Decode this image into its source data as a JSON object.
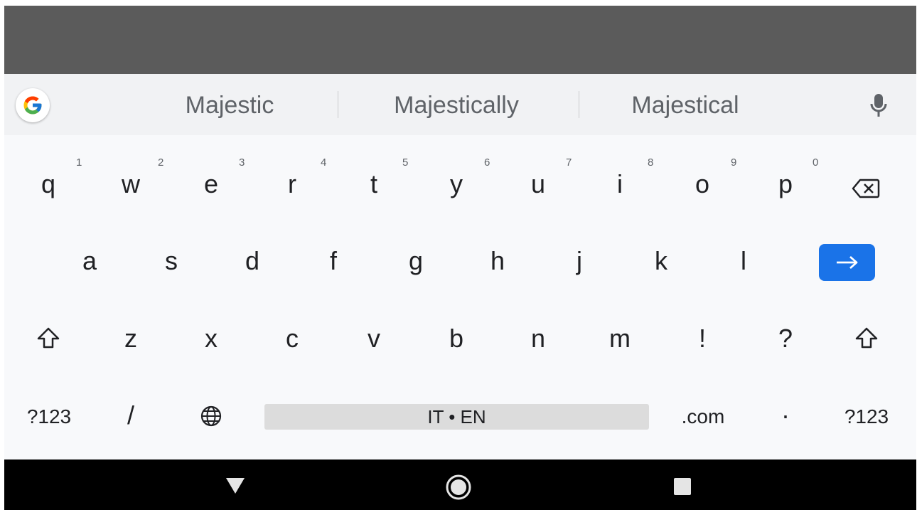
{
  "suggestions": [
    "Majestic",
    "Majestically",
    "Majestical"
  ],
  "row1": [
    {
      "ch": "q",
      "hint": "1"
    },
    {
      "ch": "w",
      "hint": "2"
    },
    {
      "ch": "e",
      "hint": "3"
    },
    {
      "ch": "r",
      "hint": "4"
    },
    {
      "ch": "t",
      "hint": "5"
    },
    {
      "ch": "y",
      "hint": "6"
    },
    {
      "ch": "u",
      "hint": "7"
    },
    {
      "ch": "i",
      "hint": "8"
    },
    {
      "ch": "o",
      "hint": "9"
    },
    {
      "ch": "p",
      "hint": "0"
    }
  ],
  "row2": [
    "a",
    "s",
    "d",
    "f",
    "g",
    "h",
    "j",
    "k",
    "l"
  ],
  "row3": [
    "z",
    "x",
    "c",
    "v",
    "b",
    "n",
    "m",
    "!",
    "?"
  ],
  "bottom": {
    "symbols_left": "?123",
    "slash": "/",
    "space": "IT • EN",
    "dotcom": ".com",
    "period": "·",
    "symbols_right": "?123"
  },
  "icons": {
    "google": "google-logo-icon",
    "mic": "microphone-icon",
    "backspace": "backspace-icon",
    "enter": "arrow-right-icon",
    "shift": "shift-icon",
    "globe": "globe-icon",
    "back": "nav-back-icon",
    "home": "nav-home-icon",
    "recents": "nav-recents-icon"
  },
  "colors": {
    "accent": "#1a73e8",
    "app_background": "#5b5b5b",
    "keyboard_background": "#f8f9fb",
    "nav_background": "#000000"
  }
}
